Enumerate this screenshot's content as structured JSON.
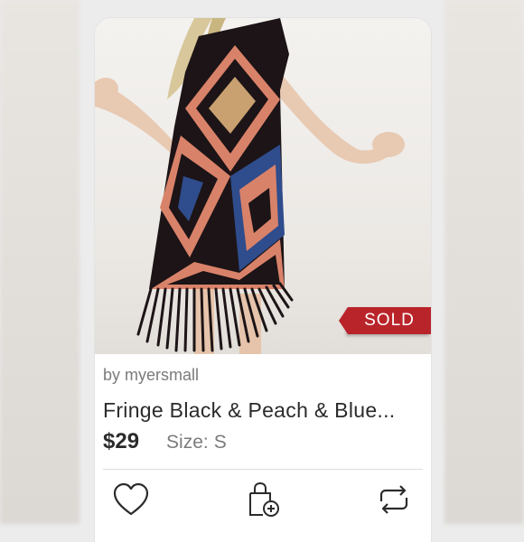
{
  "listing": {
    "seller": "by myersmall",
    "title": "Fringe Black & Peach & Blue...",
    "price": "$29",
    "size_label": "Size:",
    "size_value": "S",
    "status_badge": "SOLD"
  },
  "actions": {
    "like_icon": "heart-icon",
    "bundle_icon": "shopping-bag-plus-icon",
    "share_icon": "share-repost-icon"
  },
  "colors": {
    "badge": "#b9242a",
    "text_primary": "#2b2b2b",
    "text_secondary": "#7b7b7b"
  }
}
